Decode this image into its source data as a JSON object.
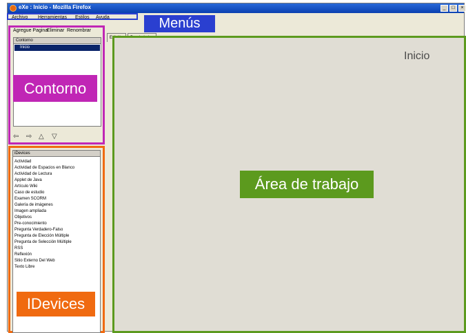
{
  "window": {
    "title": "eXe : Inicio - Mozilla Firefox",
    "controls": [
      "_",
      "□",
      "×"
    ]
  },
  "menu": {
    "items": [
      "Archivo",
      "Herramientas",
      "Estilos",
      "Ayuda"
    ]
  },
  "outline": {
    "toolbar": [
      "Agregue Pagina",
      "Eliminar",
      "Renombrar"
    ],
    "header": "Contorno",
    "nodes": [
      "Inicio"
    ],
    "nav_icons": [
      "up-left-icon",
      "down-right-icon",
      "up-triangle-icon",
      "down-triangle-icon"
    ]
  },
  "idevices": {
    "header": "iDevices",
    "items": [
      "Actividad",
      "Actividad de Espacios en Blanco",
      "Actividad de Lectura",
      "Applet de Java",
      "Artículo Wiki",
      "Caso de estudio",
      "Examen SCORM",
      "Galería de imágenes",
      "Imagen ampliada",
      "Objetivos",
      "Pre-conocimiento",
      "Pregunta Verdadero-Falso",
      "Pregunta de Elección Múltiple",
      "Pregunta de Selección Múltiple",
      "RSS",
      "Reflexión",
      "Sitio Externo Del Web",
      "Texto Libre"
    ]
  },
  "tabs": [
    "Edición",
    "Propiedades"
  ],
  "work": {
    "page_title": "Inicio"
  },
  "annotations": {
    "menus": "Menús",
    "contorno": "Contorno",
    "idevices": "IDevices",
    "work_area": "Área de trabajo"
  },
  "colors": {
    "menus": "#2a3fd0",
    "contorno": "#c026b5",
    "idevices": "#f06a10",
    "work_area": "#5c9a1e"
  }
}
